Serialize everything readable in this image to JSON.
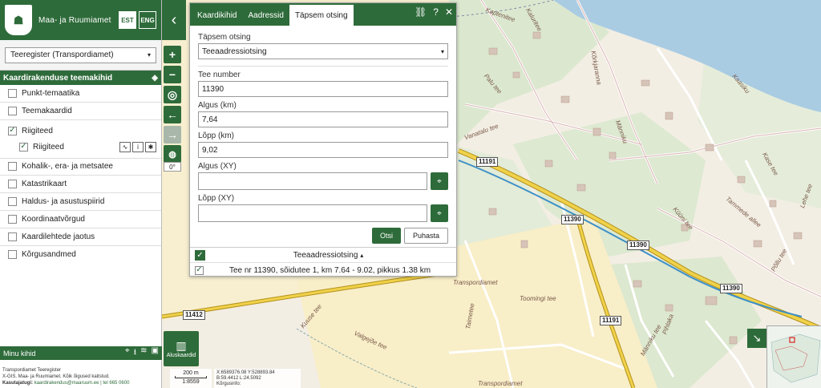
{
  "header": {
    "brand": "Maa- ja Ruumiamet",
    "lang_est": "EST",
    "lang_eng": "ENG"
  },
  "layer_select": {
    "value": "Teeregister (Transpordiamet)"
  },
  "themes": {
    "title": "Kaardirakenduse teemakihid",
    "items": [
      {
        "label": "Punkt-temaatika"
      },
      {
        "label": "Teemakaardid"
      },
      {
        "label": "Riigiteed",
        "sublabel": "Riigiteed"
      },
      {
        "label": "Kohalik-, era- ja metsatee"
      },
      {
        "label": "Katastrikaart"
      },
      {
        "label": "Haldus- ja asustuspiirid"
      },
      {
        "label": "Koordinaatvõrgud"
      },
      {
        "label": "Kaardilehtede jaotus"
      },
      {
        "label": "Kõrgusandmed"
      }
    ]
  },
  "my_layers": {
    "title": "Minu kihid"
  },
  "footer": {
    "line1": "Transpordiamet Teeregister",
    "line2": "X-GIS. Maa- ja Ruumiamet. Kõik õigused kaitstud.",
    "line3_label": "Kasutajatugi:",
    "line3_value": "kaardirakendus@maaruum.ee | tel 665 0600"
  },
  "controls": {
    "zoom_in": "+",
    "zoom_out": "−",
    "rotation": "0°",
    "basemap": "Aluskaardid"
  },
  "scale": {
    "distance": "200 m",
    "ratio": "1:8559"
  },
  "coords": {
    "xy": "X:6589376.08 Y:528893.84",
    "bl": "B:59.4412 L:24.5092",
    "extra": "Kõrgusinfo:"
  },
  "panel": {
    "tabs": [
      "Kaardikihid",
      "Aadressid",
      "Täpsem otsing"
    ],
    "search_type_label": "Täpsem otsing",
    "search_type_value": "Teeaadressiotsing",
    "road_number_label": "Tee number",
    "road_number_value": "11390",
    "start_label": "Algus (km)",
    "start_value": "7,64",
    "end_label": "Lõpp (km)",
    "end_value": "9,02",
    "start_xy_label": "Algus (XY)",
    "start_xy_value": "",
    "end_xy_label": "Lõpp (XY)",
    "end_xy_value": "",
    "search_btn": "Otsi",
    "clear_btn": "Puhasta",
    "results_title": "Teeaadressiotsing",
    "result_text": "Tee nr 11390, sõidutee 1, km 7.64 - 9.02, pikkus 1.38 km"
  },
  "map": {
    "labels": [
      "Kaptenitee",
      "Kõrkjaranna",
      "Kaluritee",
      "Kaasiku",
      "Vanatalu tee",
      "Palu tee",
      "Männiku",
      "Kase tee",
      "Tammede allee",
      "Põllu tee",
      "Lehe tee",
      "Küüni tee",
      "Pihlaka",
      "Toomingi tee",
      "Taimetee",
      "Männiku tee",
      "Valgejõe tee",
      "Kuuse tee",
      "Transpordiamet",
      "Transpordiamet"
    ],
    "road_badges": [
      "11191",
      "11390",
      "11390",
      "11412",
      "11191",
      "11390"
    ]
  },
  "colors": {
    "brand": "#2e6b3a",
    "water": "#a9cce3",
    "route": "#3c8fc8",
    "road": "#e8c640"
  }
}
